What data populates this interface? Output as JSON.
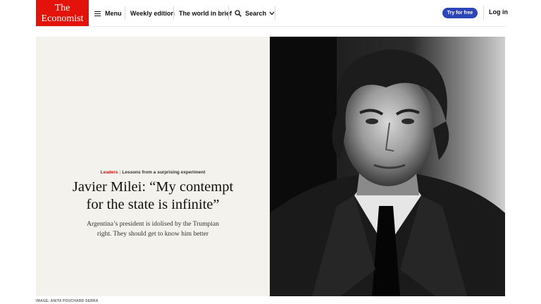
{
  "header": {
    "logo_line1": "The",
    "logo_line2": "Economist",
    "menu_label": "Menu",
    "weekly_label": "Weekly edition",
    "brief_label": "The world in brief",
    "search_label": "Search",
    "try_label": "Try for free",
    "login_label": "Log in"
  },
  "hero": {
    "section": "Leaders",
    "separator": "|",
    "flytitle": "Lessons from a surprising experiment",
    "headline_line1": "Javier Milei: “My contempt",
    "headline_line2": "for the state is infinite”",
    "rubric_line1": "Argentina’s president is idolised by the Trumpian",
    "rubric_line2": "right. They should get to know him better",
    "image_credit": "IMAGE: ANITA POUCHARD SERRA"
  },
  "colors": {
    "brand_red": "#e3120b",
    "button_blue": "#2e45b8",
    "hero_bg": "#f3f2ec"
  }
}
